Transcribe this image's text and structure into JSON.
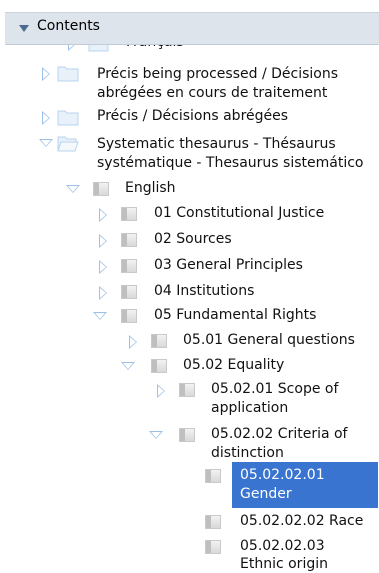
{
  "header": {
    "title": "Contents"
  },
  "tree": {
    "francais": "Français",
    "precis_processing_l1": "Précis being processed / Décisions",
    "precis_processing_l2": "abrégées en cours de traitement",
    "precis": "Précis / Décisions abrégées",
    "thesaurus_l1": "Systematic thesaurus - Thésaurus",
    "thesaurus_l2": "systématique - Thesaurus sistemático",
    "english": "English",
    "n01": "01 Constitutional Justice",
    "n02": "02 Sources",
    "n03": "03 General Principles",
    "n04": "04 Institutions",
    "n05": "05 Fundamental Rights",
    "n0501": "05.01 General questions",
    "n0502": "05.02 Equality",
    "n050201_l1": "05.02.01 Scope of",
    "n050201_l2": "application",
    "n050202_l1": "05.02.02 Criteria of",
    "n050202_l2": "distinction",
    "n05020201_l1": "05.02.02.01",
    "n05020201_l2": "Gender",
    "n05020202": "05.02.02.02 Race",
    "n05020203_l1": "05.02.02.03",
    "n05020203_l2": "Ethnic origin"
  },
  "colors": {
    "header_bg": "#dde4ec",
    "selection": "#3a74d1",
    "twisty": "#9cc0e6",
    "folder": "#b9d3ee"
  },
  "selected_node": "05.02.02.01 Gender"
}
